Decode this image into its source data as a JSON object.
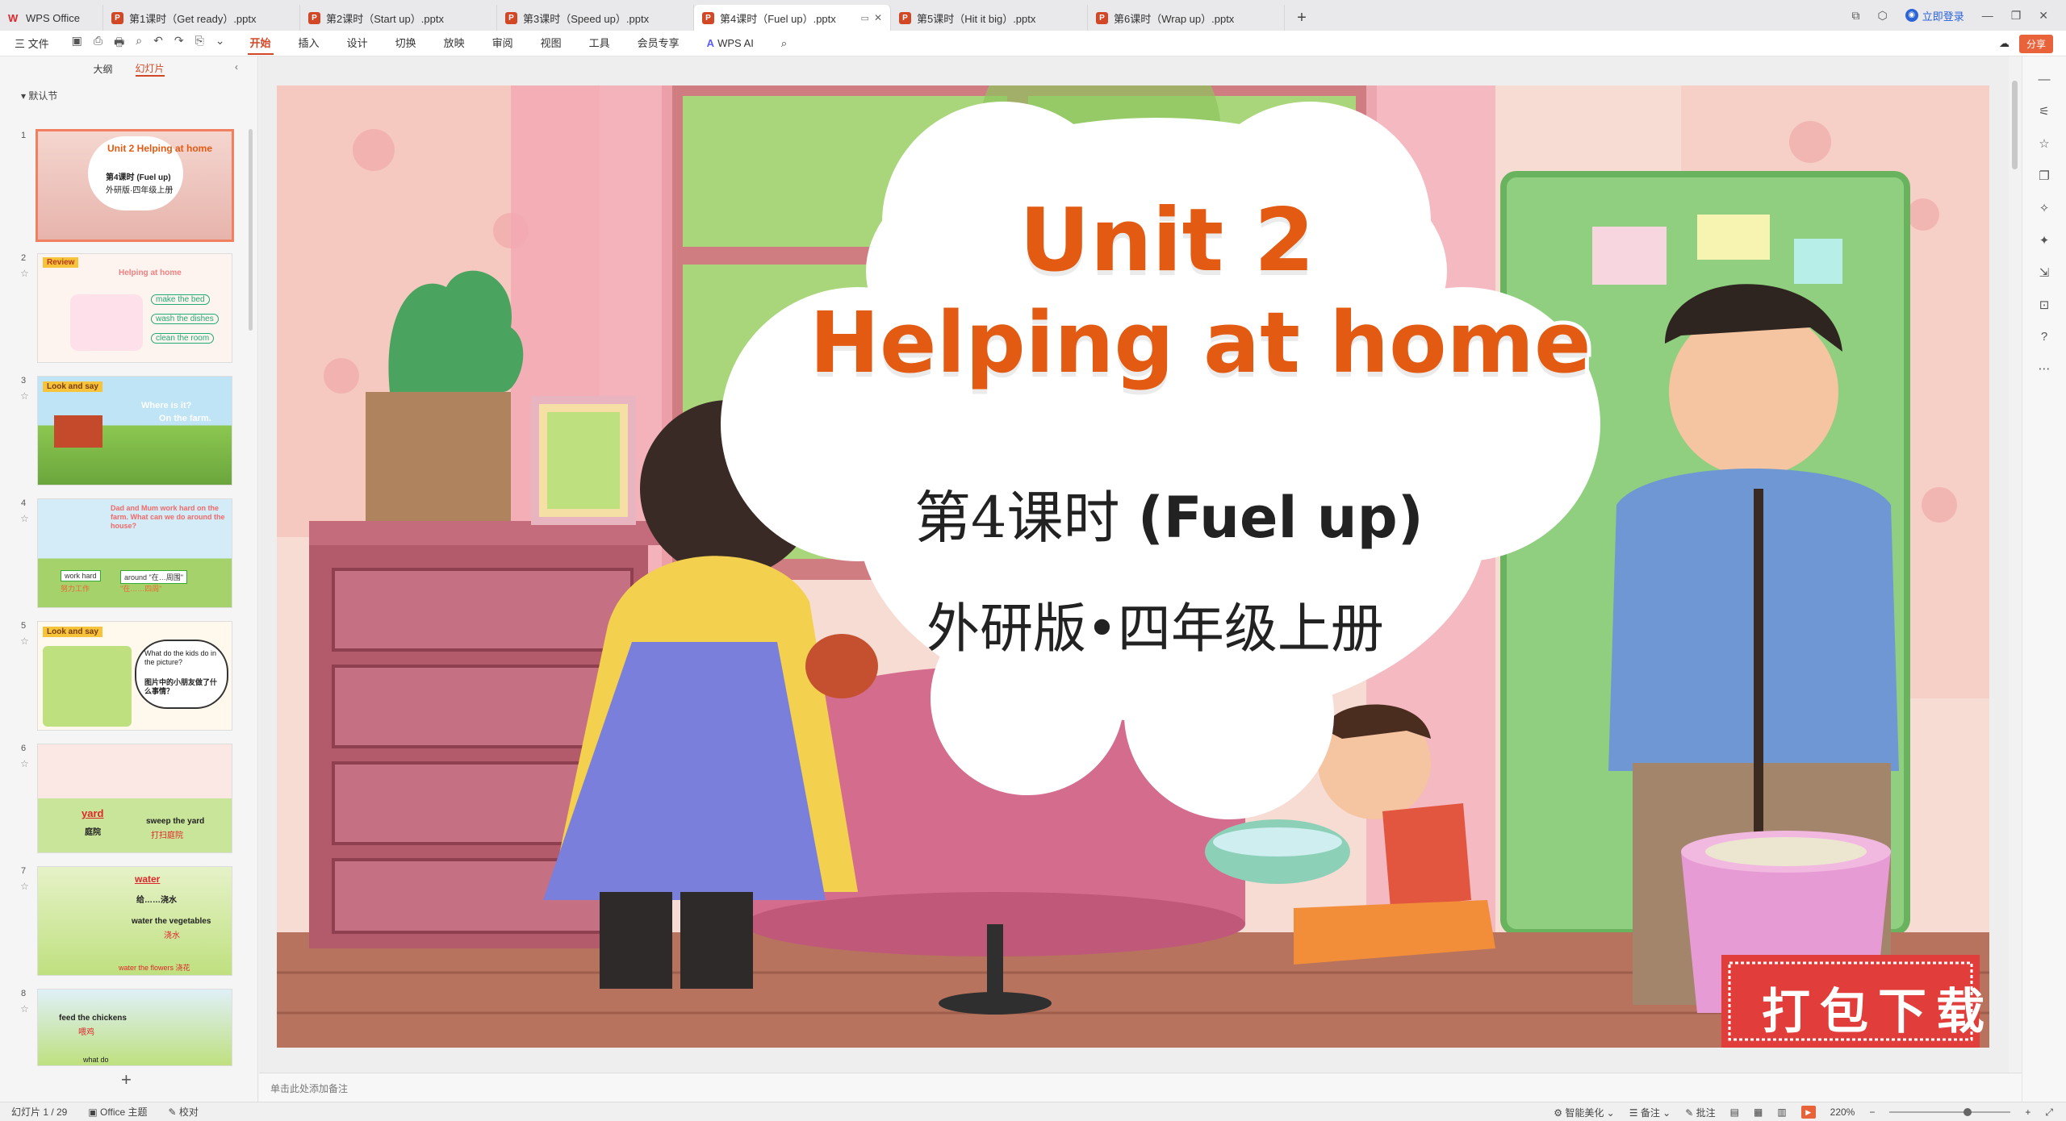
{
  "tabs": [
    {
      "label": "WPS Office",
      "kind": "home"
    },
    {
      "label": "第1课时（Get ready）.pptx",
      "kind": "ppt"
    },
    {
      "label": "第2课时（Start up）.pptx",
      "kind": "ppt"
    },
    {
      "label": "第3课时（Speed up）.pptx",
      "kind": "ppt"
    },
    {
      "label": "第4课时（Fuel up）.pptx",
      "kind": "ppt",
      "active": true
    },
    {
      "label": "第5课时（Hit it big）.pptx",
      "kind": "ppt"
    },
    {
      "label": "第6课时（Wrap up）.pptx",
      "kind": "ppt"
    }
  ],
  "titlebar": {
    "login": "立即登录"
  },
  "menu": {
    "file": "三 文件",
    "items": [
      "开始",
      "插入",
      "设计",
      "切换",
      "放映",
      "审阅",
      "视图",
      "工具",
      "会员专享",
      "WPS AI"
    ],
    "share": "分享"
  },
  "leftpanel": {
    "tab_outline": "大纲",
    "tab_slides": "幻灯片",
    "section": "默认节",
    "thumbs": [
      {
        "num": "1",
        "text": "Unit 2 Helping at home",
        "sub": "第4课时 (Fuel up)",
        "pub": "外研版·四年级上册"
      },
      {
        "num": "2",
        "text": "Review",
        "sub": "Helping at home",
        "items": [
          "make the bed",
          "wash the dishes",
          "clean the room"
        ]
      },
      {
        "num": "3",
        "text": "Look and say",
        "sub": "Where is it?",
        "sub2": "On the farm."
      },
      {
        "num": "4",
        "text": "Dad and Mum work hard on the farm. What can we do around the house?",
        "items": [
          "work hard",
          "努力工作",
          "around \"在…周围\"",
          "\"在……四周\""
        ]
      },
      {
        "num": "5",
        "text": "Look and say",
        "sub": "What do the kids do in the picture?",
        "sub2": "图片中的小朋友做了什么事情？"
      },
      {
        "num": "6",
        "text": "yard",
        "sub": "庭院",
        "items": [
          "sweep the yard",
          "打扫庭院"
        ]
      },
      {
        "num": "7",
        "text": "water",
        "sub": "给……浇水",
        "items": [
          "water the vegetables",
          "浇水",
          "water the flowers 浇花"
        ]
      },
      {
        "num": "8",
        "text": "feed the chickens",
        "sub": "喂鸡",
        "items": [
          "what do"
        ]
      }
    ]
  },
  "slide": {
    "title_line1": "Unit 2",
    "title_line2": "Helping at home",
    "lesson": "第4课时",
    "lesson_en": "(Fuel up)",
    "publisher": "外研版•四年级上册",
    "badge": "打包下载"
  },
  "notes_placeholder": "单击此处添加备注",
  "status": {
    "slide_counter": "幻灯片 1 / 29",
    "theme": "Office 主题",
    "proof": "校对",
    "beautify": "智能美化",
    "notes": "备注",
    "comments": "批注",
    "zoom": "220%"
  },
  "colors": {
    "accent": "#d24726",
    "title_orange": "#e35a12"
  }
}
